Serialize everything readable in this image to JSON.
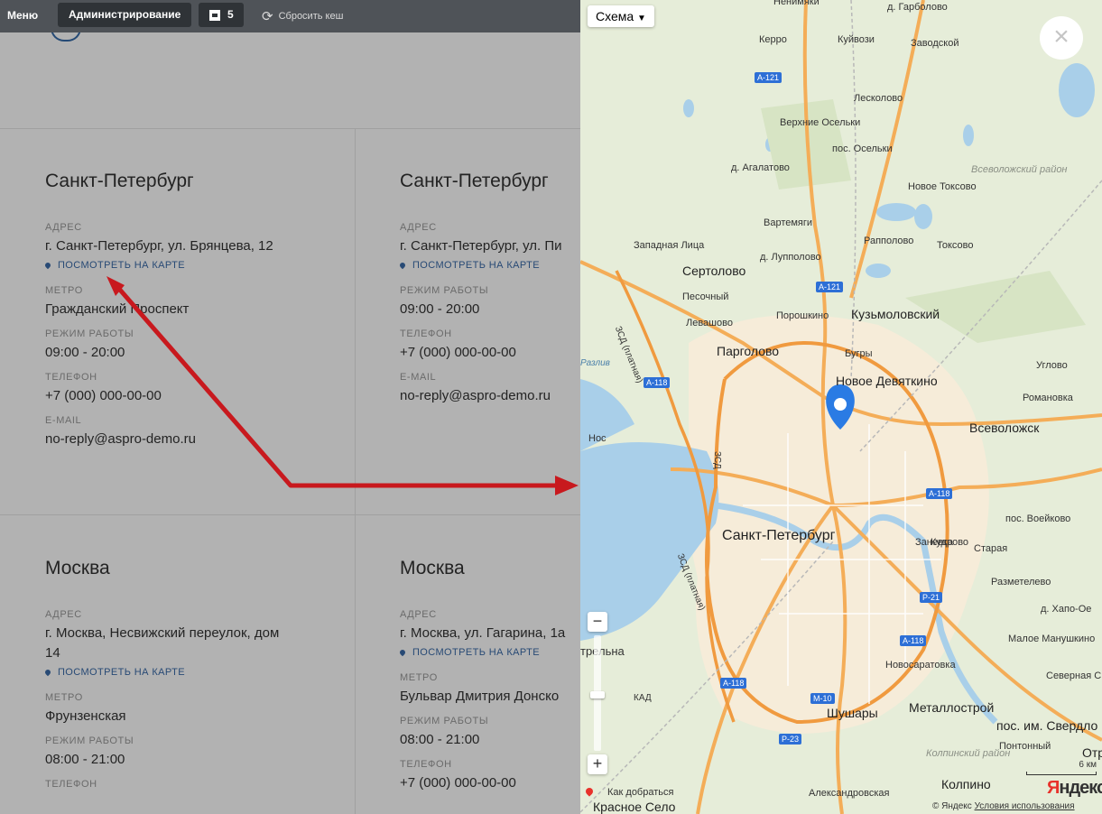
{
  "topbar": {
    "menu": "Меню",
    "admin": "Администрирование",
    "count": "5",
    "reset_cache": "Сбросить кеш"
  },
  "cards": [
    {
      "city": "Санкт-Петербург",
      "address_label": "АДРЕС",
      "address": "г. Санкт-Петербург, ул. Брянцева, 12",
      "map_link": "ПОСМОТРЕТЬ НА КАРТЕ",
      "metro_label": "МЕТРО",
      "metro": "Гражданский Проспект",
      "hours_label": "РЕЖИМ РАБОТЫ",
      "hours": "09:00 - 20:00",
      "phone_label": "ТЕЛЕФОН",
      "phone": "+7 (000) 000-00-00",
      "email_label": "E-MAIL",
      "email": "no-reply@aspro-demo.ru"
    },
    {
      "city": "Санкт-Петербург",
      "address_label": "АДРЕС",
      "address": "г. Санкт-Петербург, ул. Пи",
      "map_link": "ПОСМОТРЕТЬ НА КАРТЕ",
      "hours_label": "РЕЖИМ РАБОТЫ",
      "hours": "09:00 - 20:00",
      "phone_label": "ТЕЛЕФОН",
      "phone": "+7 (000) 000-00-00",
      "email_label": "E-MAIL",
      "email": "no-reply@aspro-demo.ru"
    },
    {
      "city": "Москва",
      "address_label": "АДРЕС",
      "address": "г. Москва, Несвижский переулок, дом 14",
      "map_link": "ПОСМОТРЕТЬ НА КАРТЕ",
      "metro_label": "МЕТРО",
      "metro": "Фрунзенская",
      "hours_label": "РЕЖИМ РАБОТЫ",
      "hours": "08:00 - 21:00",
      "phone_label": "ТЕЛЕФОН"
    },
    {
      "city": "Москва",
      "address_label": "АДРЕС",
      "address": "г. Москва, ул. Гагарина, 1а",
      "map_link": "ПОСМОТРЕТЬ НА КАРТЕ",
      "metro_label": "МЕТРО",
      "metro": "Бульвар Дмитрия Донско",
      "hours_label": "РЕЖИМ РАБОТЫ",
      "hours": "08:00 - 21:00",
      "phone_label": "ТЕЛЕФОН",
      "phone": "+7 (000) 000-00-00"
    }
  ],
  "map": {
    "type_selector": "Схема",
    "close": "×",
    "zoom_in": "+",
    "zoom_out": "−",
    "route": "Как добраться",
    "scale": "6 км",
    "logo_main": "Я",
    "logo_rest": "ндекс",
    "copyright": "© Яндекс",
    "terms": "Условия использования",
    "labels": {
      "nenimyaki": "Ненимяки",
      "garbolovo": "д. Гарболово",
      "kerro": "Керро",
      "kuyvozi": "Куйвози",
      "zavodskoy": "Заводской",
      "leskolovo": "Лесколово",
      "verkh_oselki": "Верхние Осельки",
      "pos_oselki": "пос. Осельки",
      "agalatovo": "д. Агалатово",
      "vsevolozh_rayon": "Всеволожский район",
      "novoe_toksovo": "Новое Токсово",
      "vartemyagi": "Вартемяги",
      "zapadnaya_litsa": "Западная Лица",
      "luppolovo": "д. Лупполово",
      "rappolovo": "Рапполово",
      "toksovo": "Токсово",
      "sertolovo": "Сертолово",
      "pesochny": "Песочный",
      "levashovo": "Левашово",
      "poroshkino": "Порошкино",
      "kuzmolovsky": "Кузьмоловский",
      "bugry": "Бугры",
      "pargolovo": "Парголово",
      "novoe_devyatkino": "Новое Девяткино",
      "uglovo": "Углово",
      "razliv": "Разлив",
      "romanovka": "Романовка",
      "vsevolozhsk": "Всеволожск",
      "nos": "Нос",
      "spb": "Санкт-Петербург",
      "zanevka": "Заневка",
      "kudrovo": "Кудрово",
      "voeykovo": "пос. Воейково",
      "staraya": "Старая",
      "razmetelevo": "Разметелево",
      "khapoe": "д. Хапо-Ое",
      "manushkino": "Малое Манушкино",
      "severnaya": "Северная С",
      "strelna": "трельна",
      "novosaratovka": "Новосаратовка",
      "shushary": "Шушары",
      "metallostroy": "Металлострой",
      "sverdlova": "пос. им. Свердло",
      "kolpino_rayon": "Колпинский район",
      "pontonny": "Понтонный",
      "otr": "Отр",
      "kolpino": "Колпино",
      "aleksandrovskaya": "Александровская",
      "krasnoe_selo": "Красное Село",
      "zsd1": "ЗСД (платная)",
      "zsd2": "ЗСД (платная)",
      "zsd3": "ЗСД",
      "kad": "КАД",
      "a121": "А-121",
      "a118": "А-118",
      "r21": "Р-21",
      "m10": "М-10",
      "p23": "Р-23"
    }
  },
  "colors": {
    "accent": "#3a6aa8",
    "arrow": "#c8191e",
    "map_pin": "#2a7be4",
    "road": "#f4ad58",
    "water": "#a9cfe9"
  }
}
